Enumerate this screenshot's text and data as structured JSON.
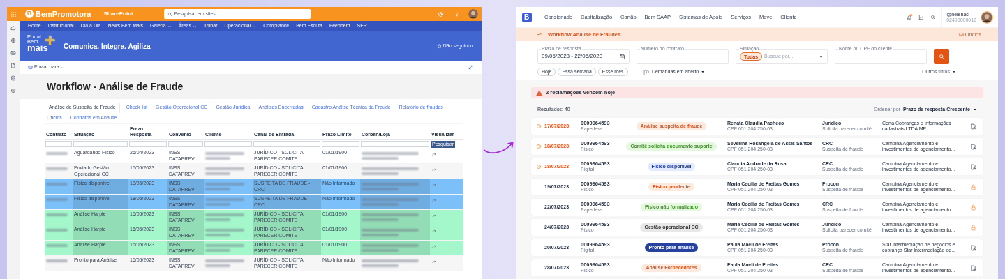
{
  "before": {
    "suite_bar": {
      "brand_mark": "B",
      "brand": "BemPromotora",
      "app": "SharePoint",
      "search_placeholder": "Pesquisar em sites"
    },
    "nav": [
      {
        "label": "Home",
        "dropdown": false
      },
      {
        "label": "Institucional",
        "dropdown": false
      },
      {
        "label": "Dia a Dia",
        "dropdown": false
      },
      {
        "label": "News Bem Mais",
        "dropdown": false
      },
      {
        "label": "Galeria",
        "dropdown": true
      },
      {
        "label": "Áreas",
        "dropdown": true
      },
      {
        "label": "Trilhar",
        "dropdown": false
      },
      {
        "label": "Operacional",
        "dropdown": true
      },
      {
        "label": "Compliance",
        "dropdown": false
      },
      {
        "label": "Bem Escuta",
        "dropdown": false
      },
      {
        "label": "Feedbem",
        "dropdown": false
      },
      {
        "label": "SER",
        "dropdown": false
      }
    ],
    "site": {
      "logo_lines": [
        "Portal",
        "Bem",
        "mais"
      ],
      "tagline": "Comunica. Integra. Agiliza",
      "follow": "Não seguindo"
    },
    "toolbar": {
      "send": "Enviar para"
    },
    "page_title": "Workflow - Análise de Fraude",
    "tabs": [
      {
        "label": "Análise de Suspeita de Fraude",
        "selected": true
      },
      {
        "label": "Check list",
        "selected": false
      },
      {
        "label": "Gestão Operacional CC",
        "selected": false
      },
      {
        "label": "Gestão Jurídica",
        "selected": false
      },
      {
        "label": "Análises Encerradas",
        "selected": false
      },
      {
        "label": "Cadastro Análise Técnica da Fraude",
        "selected": false
      },
      {
        "label": "Relatório de fraudes",
        "selected": false
      },
      {
        "label": "Ofícios",
        "selected": false
      },
      {
        "label": "Contratos em Análise",
        "selected": false
      }
    ],
    "table": {
      "columns": [
        "Contrato",
        "Situação",
        "Prazo Resposta",
        "Convênio",
        "Cliente",
        "Canal de Entrada",
        "Prazo Limite",
        "Corban/Loja",
        "Visualizar"
      ],
      "filter_button": "Pesquisar",
      "rows": [
        {
          "color": "#ffffff",
          "situacao": "Aguardando Físico",
          "prazo_resposta": "26/04/2023",
          "convenio": "INSS DATAPREV",
          "canal": "JURÍDICO - SOLICITA PARECER COMITE",
          "prazo_limite": "01/01/1900"
        },
        {
          "color": "#f6f6f6",
          "situacao": "Enviado Gestão Operacional CC",
          "prazo_resposta": "15/05/2023",
          "convenio": "INSS DATAPREV",
          "canal": "JURÍDICO - SOLICITA PARECER COMITE",
          "prazo_limite": "01/01/1900"
        },
        {
          "color": "#7cc0fa",
          "situacao": "Físico disponível",
          "prazo_resposta": "18/05/2023",
          "convenio": "INSS DATAPREV",
          "canal": "SUSPEITA DE FRAUDE - CRC",
          "prazo_limite": "Não Informado"
        },
        {
          "color": "#7cc0fa",
          "situacao": "Físico disponível",
          "prazo_resposta": "18/05/2023",
          "convenio": "INSS DATAPREV",
          "canal": "SUSPEITA DE FRAUDE - CRC",
          "prazo_limite": "Não Informado"
        },
        {
          "color": "#a3f7cb",
          "situacao": "Análise Harpie",
          "prazo_resposta": "15/05/2023",
          "convenio": "INSS DATAPREV",
          "canal": "JURÍDICO - SOLICITA PARECER COMITE",
          "prazo_limite": "01/01/1900"
        },
        {
          "color": "#a3f7cb",
          "situacao": "Análise Harpie",
          "prazo_resposta": "16/05/2023",
          "convenio": "INSS DATAPREV",
          "canal": "JURÍDICO - SOLICITA PARECER COMITE",
          "prazo_limite": "01/01/1900"
        },
        {
          "color": "#a3f7cb",
          "situacao": "Análise Harpie",
          "prazo_resposta": "16/05/2023",
          "convenio": "INSS DATAPREV",
          "canal": "JURÍDICO - SOLICITA PARECER COMITE",
          "prazo_limite": "01/01/1900"
        },
        {
          "color": "#f6f6f6",
          "situacao": "Pronto para Análise",
          "prazo_resposta": "16/05/2023",
          "convenio": "INSS DATAPREV",
          "canal": "JURÍDICO - SOLICITA PARECER COMITE",
          "prazo_limite": "Não Informado"
        }
      ]
    }
  },
  "after": {
    "logo": "B",
    "nav": [
      "Consignado",
      "Capitalização",
      "Cartão",
      "Bem SAAP",
      "Sistemas de Apoio",
      "Serviços",
      "Move",
      "Cliente"
    ],
    "user": {
      "handle": "@helenac",
      "id": "02490000012"
    },
    "banner": {
      "title": "Workflow Análise de Fraudes",
      "link": "Ofícios"
    },
    "filters": {
      "prazo": {
        "label": "Prazo de resposta",
        "value": "09/05/2023 - 22/05/2023"
      },
      "contrato": {
        "label": "Número do contrato"
      },
      "situacao": {
        "label": "Situação",
        "chip": "Todas",
        "placeholder": "Busque por..."
      },
      "cliente": {
        "label": "Nome ou CPF do cliente"
      },
      "quick": [
        "Hoje",
        "Essa semana",
        "Esse mês"
      ],
      "tipo_label": "Tipo",
      "tipo_value": "Demandas em aberto",
      "more": "Outros filtros"
    },
    "alert": "2 reclamações vencem hoje",
    "results": "Resultados: 40",
    "sort_label": "Ordenar por",
    "sort_value": "Prazo de resposta Crescente",
    "cards": [
      {
        "date": "17/07/2023",
        "overdue": true,
        "contract": "0009964593",
        "type": "Paperless",
        "status": {
          "label": "Análise suspeita de fraude",
          "kind": "orange"
        },
        "name": "Renata Claudia Pacheco",
        "cpf": "CPF 051.204.250-03",
        "channel": "Jurídico",
        "reason": "Solicita parecer comitê",
        "company": [
          "Certa Cobranças e informações",
          "cadastrais LTDA ME"
        ],
        "locked": false
      },
      {
        "date": "18/07/2023",
        "overdue": true,
        "contract": "0009964593",
        "type": "Físico",
        "status": {
          "label": "Comitê solicita documento suporte",
          "kind": "green"
        },
        "name": "Severina Rosangela de Assis Santos",
        "cpf": "CPF 051.204.250-03",
        "channel": "CRC",
        "reason": "Suspeita de fraude",
        "company": [
          "Campina Agenciamento e",
          "investimentos de agenciamento..."
        ],
        "locked": false
      },
      {
        "date": "18/07/2023",
        "overdue": true,
        "contract": "0009964593",
        "type": "Fígital",
        "status": {
          "label": "Físico disponível",
          "kind": "blue"
        },
        "name": "Claudia Andrade da Rosa",
        "cpf": "CPF 051.204.250-03",
        "channel": "CRC",
        "reason": "Suspeita de fraude",
        "company": [
          "Campina Agenciamento e",
          "investimentos de agenciamento..."
        ],
        "locked": false
      },
      {
        "date": "19/07/2023",
        "overdue": false,
        "contract": "0009964593",
        "type": "Físico",
        "status": {
          "label": "Físico pendente",
          "kind": "orange"
        },
        "name": "Maria Cecília de Freitas Gomes",
        "cpf": "CPF 051.204.250-03",
        "channel": "Procon",
        "reason": "Suspeita de fraude",
        "company": [
          "Campina Agenciamento e",
          "investimentos de agenciamento..."
        ],
        "locked": true
      },
      {
        "date": "22/07/2023",
        "overdue": false,
        "contract": "0009964593",
        "type": "Paperless",
        "status": {
          "label": "Físico não formalizado",
          "kind": "green"
        },
        "name": "Maria Cecília de Freitas Gomes",
        "cpf": "CPF 051.204.250-03",
        "channel": "CRC",
        "reason": "Suspeita de fraude",
        "company": [
          "Campina Agenciamento e",
          "investimentos de agenciamento..."
        ],
        "locked": true
      },
      {
        "date": "24/07/2023",
        "overdue": false,
        "contract": "0009964593",
        "type": "Físico",
        "status": {
          "label": "Gestão operacional CC",
          "kind": "gray"
        },
        "name": "Maria Cecília de Freitas Gomes",
        "cpf": "CPF 051.204.250-03",
        "channel": "Jurídico",
        "reason": "Solicita parecer comitê",
        "company": [
          "Campina Agenciamento e",
          "investimentos de agenciamento..."
        ],
        "locked": true
      },
      {
        "date": "20/07/2023",
        "overdue": false,
        "contract": "0009964593",
        "type": "Fígital",
        "status": {
          "label": "Pronto para análise",
          "kind": "solid"
        },
        "name": "Paula Maeli de Freitas",
        "cpf": "CPF 051.204.250-03",
        "channel": "Procon",
        "reason": "Suspeita de fraude",
        "company": [
          "Star intermediação de negócios e",
          "cobrança Star intermediação de..."
        ],
        "locked": false
      },
      {
        "date": "28/07/2023",
        "overdue": false,
        "contract": "0009964593",
        "type": "Físico",
        "status": {
          "label": "Análise Fornecedores",
          "kind": "orange"
        },
        "name": "Paula Maeli de Freitas",
        "cpf": "CPF 051.204.250-03",
        "channel": "CRC",
        "reason": "Suspeita de fraude",
        "company": [
          "Campina Agenciamento e",
          "investimentos de agenciamento..."
        ],
        "locked": false
      }
    ]
  }
}
